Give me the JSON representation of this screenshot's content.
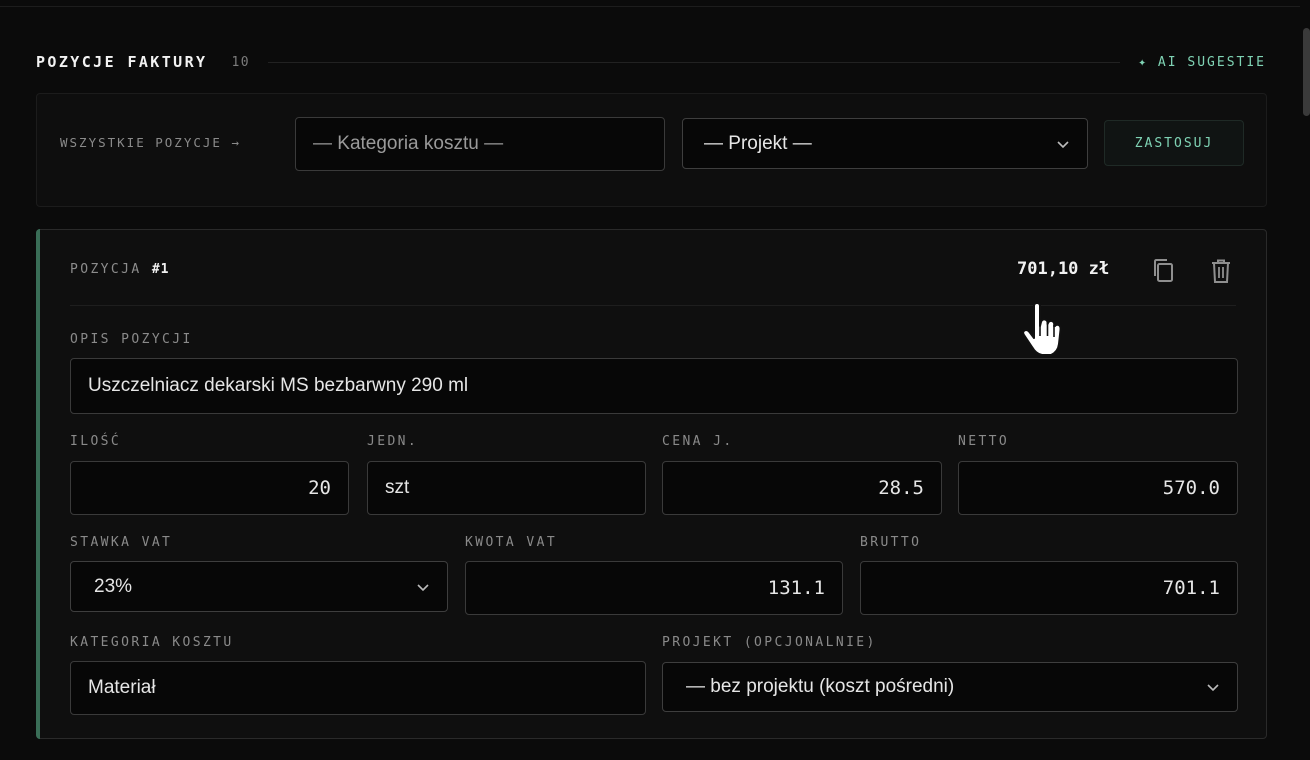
{
  "section": {
    "title": "POZYCJE FAKTURY",
    "count": "10",
    "ai_button": "✦ AI SUGESTIE"
  },
  "bulk": {
    "label": "WSZYSTKIE POZYCJE →",
    "category_placeholder": "— Kategoria kosztu —",
    "project_selected": "— Projekt —",
    "apply_label": "ZASTOSUJ"
  },
  "item": {
    "title_prefix": "POZYCJA",
    "number": "#1",
    "total": "701,10 zł",
    "labels": {
      "description": "OPIS POZYCJI",
      "quantity": "ILOŚĆ",
      "unit": "JEDN.",
      "unit_price": "CENA J.",
      "net": "NETTO",
      "vat_rate": "STAWKA VAT",
      "vat_amount": "KWOTA VAT",
      "gross": "BRUTTO",
      "category": "KATEGORIA KOSZTU",
      "project": "PROJEKT (OPCJONALNIE)"
    },
    "values": {
      "description": "Uszczelniacz dekarski MS bezbarwny 290 ml",
      "quantity": "20",
      "unit": "szt",
      "unit_price": "28.5",
      "net": "570.0",
      "vat_rate": "23%",
      "vat_amount": "131.1",
      "gross": "701.1",
      "category": "Materiał",
      "project": "— bez projektu (koszt pośredni)"
    }
  },
  "colors": {
    "accent": "#7fd3b4",
    "card_accent": "#3a6e57",
    "background": "#0b0b0b"
  },
  "icons": [
    "copy-icon",
    "trash-icon",
    "chevron-down-icon",
    "hand-pointer-cursor"
  ]
}
